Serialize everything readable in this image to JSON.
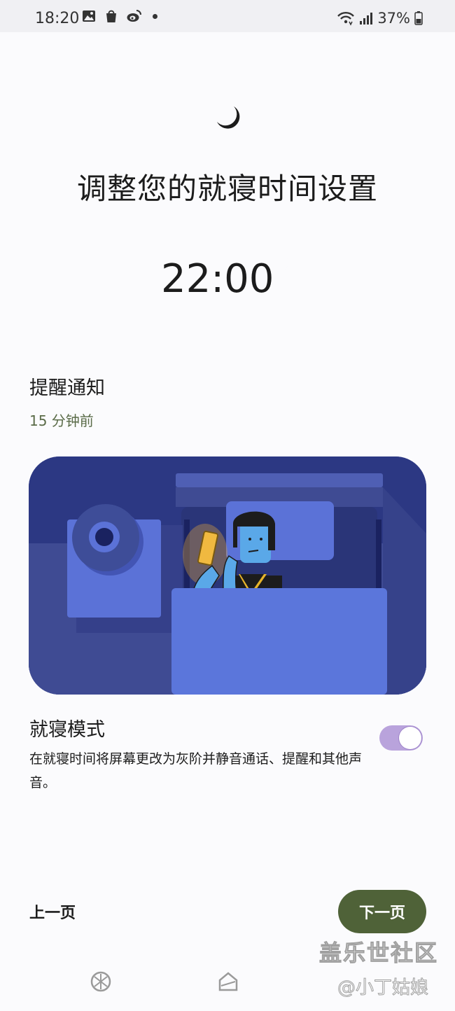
{
  "status_bar": {
    "time": "18:20",
    "battery": "37%",
    "icons": [
      "gallery-icon",
      "shopping-bag-icon",
      "weibo-icon",
      "notification-dot-icon",
      "wifi-icon",
      "signal-icon",
      "battery-icon"
    ]
  },
  "header": {
    "icon": "moon-icon",
    "title": "调整您的就寝时间设置"
  },
  "bedtime": {
    "time": "22:00",
    "icon": "moon-icon"
  },
  "reminder": {
    "title": "提醒通知",
    "value": "15 分钟前"
  },
  "illustration": {
    "description_icon": "person-in-bed-with-phone-illustration"
  },
  "bedtime_mode": {
    "title": "就寝模式",
    "description": "在就寝时间将屏幕更改为灰阶并静音通话、提醒和其他声音。",
    "enabled": true
  },
  "footer": {
    "prev_label": "上一页",
    "next_label": "下一页"
  },
  "watermark": {
    "main": "盖乐世社区",
    "sub": "@小丁姑娘"
  },
  "colors": {
    "accent_green": "#4f6238",
    "toggle_purple": "#b9a3dc",
    "reminder_green": "#5a6b48",
    "illustration_navy": "#2d3a84"
  }
}
